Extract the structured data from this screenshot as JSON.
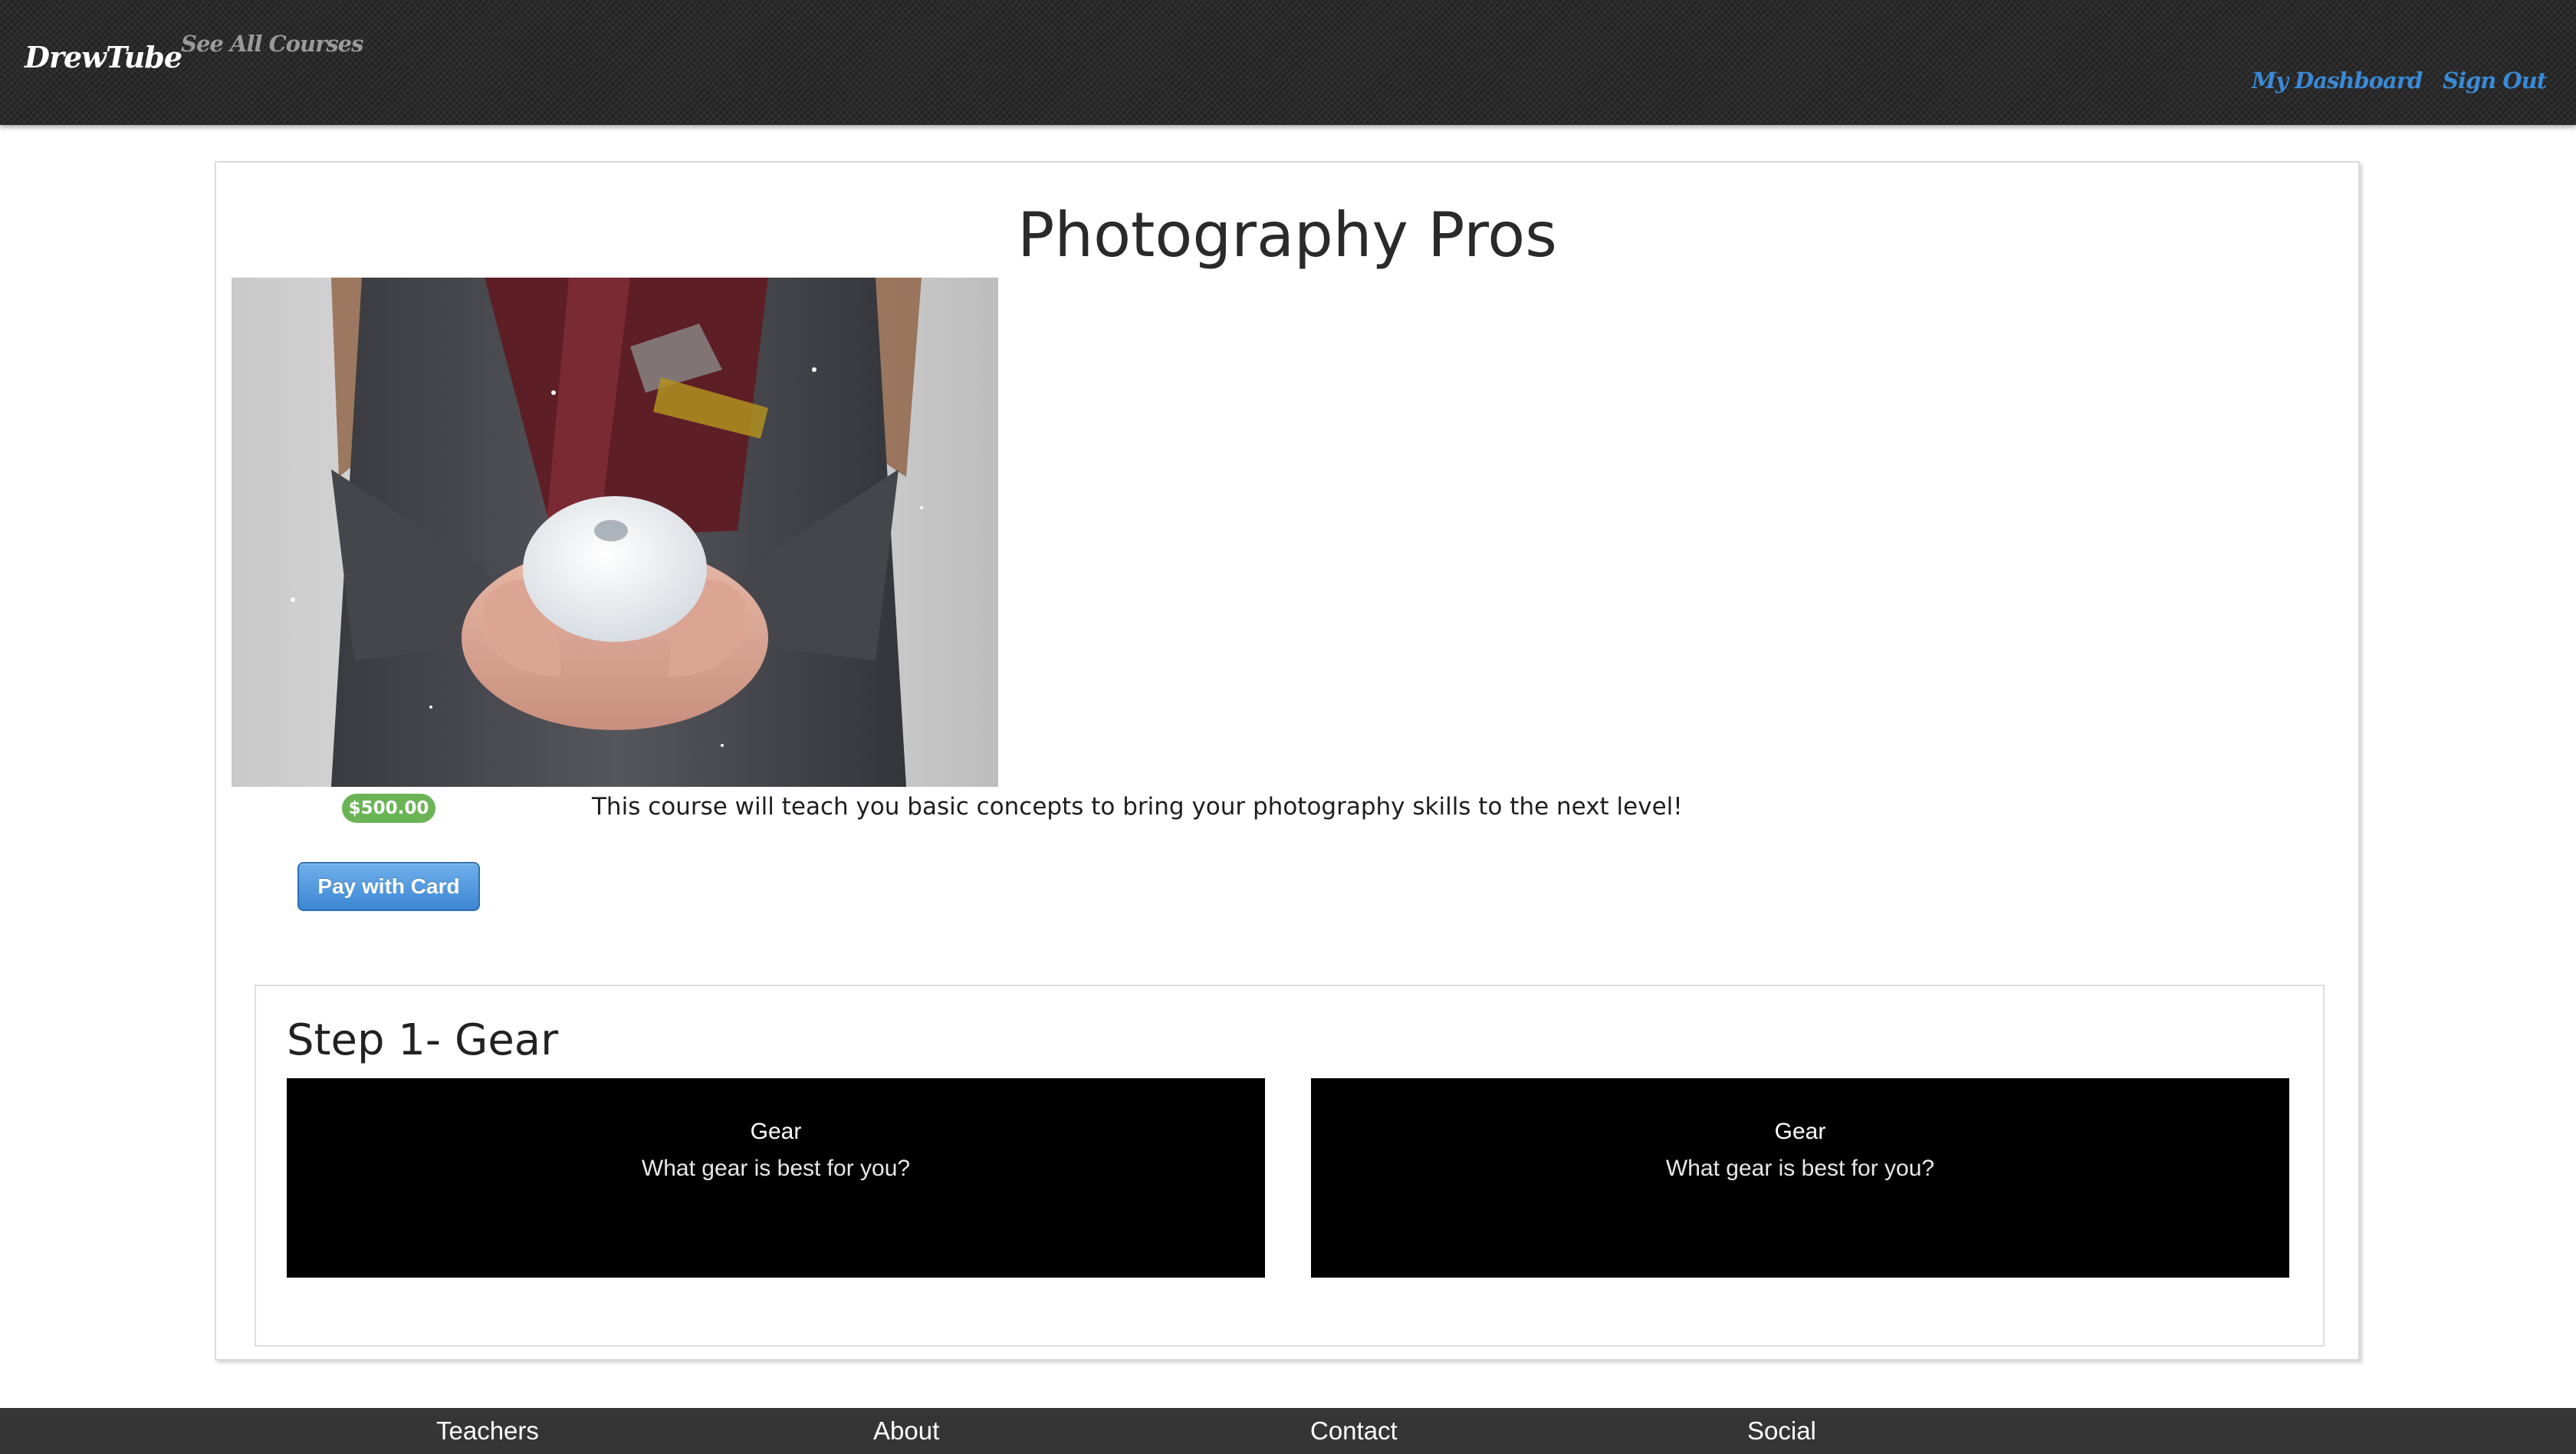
{
  "navbar": {
    "brand": "DrewTube",
    "see_all_courses": "See All Courses",
    "my_dashboard": "My Dashboard",
    "sign_out": "Sign Out"
  },
  "course": {
    "title": "Photography Pros",
    "image_alt": "Hands holding a snowball",
    "price": "$500.00",
    "description": "This course will teach you basic concepts to bring your photography skills to the next level!",
    "pay_button": "Pay with Card"
  },
  "steps": [
    {
      "title": "Step 1- Gear",
      "lessons": [
        {
          "name": "Gear",
          "description": "What gear is best for you?"
        },
        {
          "name": "Gear",
          "description": "What gear is best for you?"
        }
      ]
    }
  ],
  "footer": {
    "links": [
      "Teachers",
      "About",
      "Contact",
      "Social"
    ]
  },
  "colors": {
    "navbar_bg": "#2b2b2b",
    "nav_link_accent": "#3a8ad6",
    "price_badge": "#6ab455",
    "pay_button": "#3c86d3",
    "lesson_tile_bg": "#000000",
    "footer_bg": "#353535"
  }
}
